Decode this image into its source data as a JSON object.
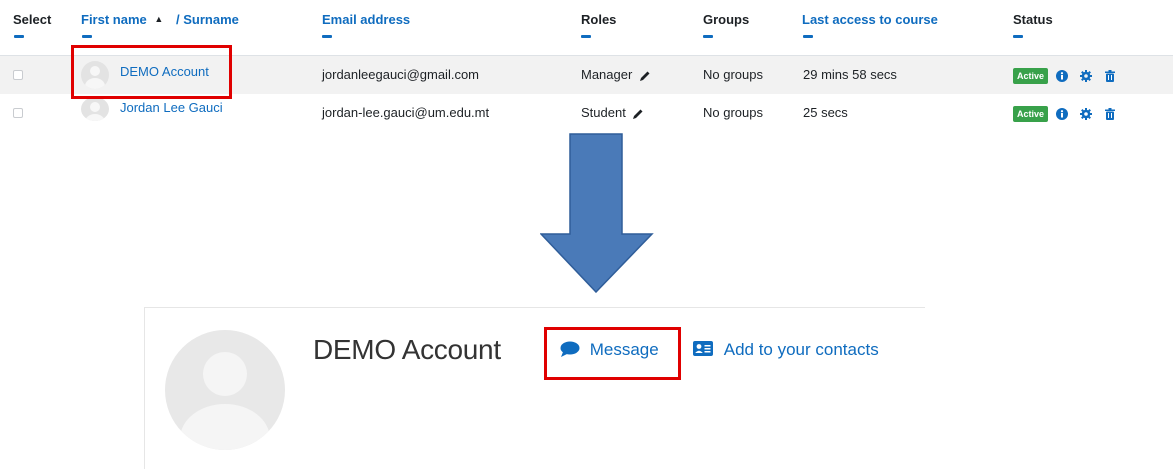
{
  "table": {
    "headers": {
      "select": "Select",
      "first_name": "First name",
      "sort_indicator": "▲",
      "surname": "/ Surname",
      "email": "Email address",
      "roles": "Roles",
      "groups": "Groups",
      "last_access": "Last access to course",
      "status": "Status"
    },
    "rows": [
      {
        "name": "DEMO Account",
        "email": "jordanleegauci@gmail.com",
        "role": "Manager",
        "groups": "No groups",
        "last_access": "29 mins 58 secs",
        "status": "Active"
      },
      {
        "name": "Jordan Lee Gauci",
        "email": "jordan-lee.gauci@um.edu.mt",
        "role": "Student",
        "groups": "No groups",
        "last_access": "25 secs",
        "status": "Active"
      }
    ]
  },
  "profile": {
    "name": "DEMO Account",
    "message_label": "Message",
    "contacts_label": "Add to your contacts"
  },
  "colors": {
    "link": "#0f6cbf",
    "highlight_box": "#e00000",
    "arrow_fill": "#4a7ab8",
    "status_active": "#38a14a"
  },
  "icons": {
    "edit_role": "pencil-icon",
    "info": "info-icon",
    "settings": "gear-icon",
    "delete": "trash-icon",
    "message": "speech-bubble-icon",
    "contacts": "address-card-icon",
    "pointer": "down-arrow"
  }
}
